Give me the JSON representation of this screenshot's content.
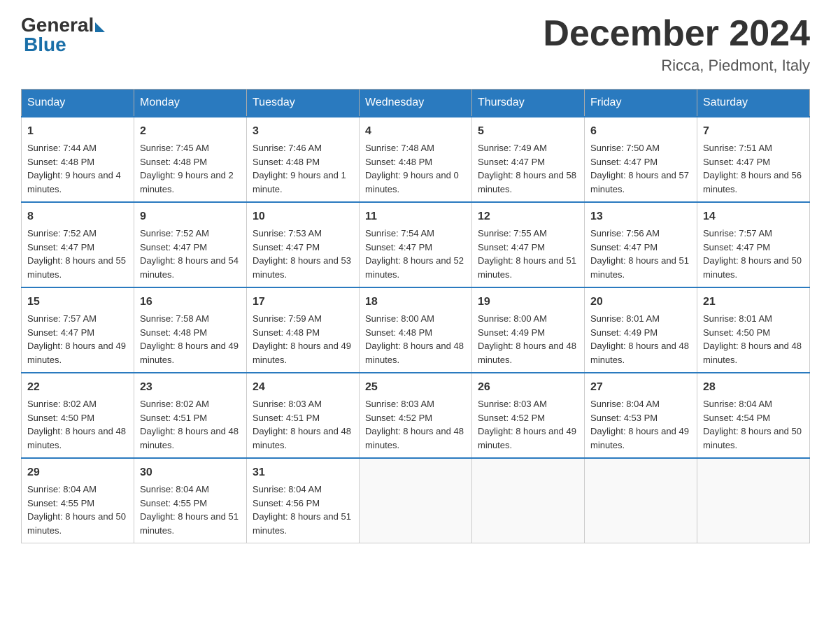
{
  "logo": {
    "general": "General",
    "blue": "Blue"
  },
  "title": "December 2024",
  "subtitle": "Ricca, Piedmont, Italy",
  "days_of_week": [
    "Sunday",
    "Monday",
    "Tuesday",
    "Wednesday",
    "Thursday",
    "Friday",
    "Saturday"
  ],
  "weeks": [
    [
      {
        "day": "1",
        "sunrise": "7:44 AM",
        "sunset": "4:48 PM",
        "daylight": "9 hours and 4 minutes."
      },
      {
        "day": "2",
        "sunrise": "7:45 AM",
        "sunset": "4:48 PM",
        "daylight": "9 hours and 2 minutes."
      },
      {
        "day": "3",
        "sunrise": "7:46 AM",
        "sunset": "4:48 PM",
        "daylight": "9 hours and 1 minute."
      },
      {
        "day": "4",
        "sunrise": "7:48 AM",
        "sunset": "4:48 PM",
        "daylight": "9 hours and 0 minutes."
      },
      {
        "day": "5",
        "sunrise": "7:49 AM",
        "sunset": "4:47 PM",
        "daylight": "8 hours and 58 minutes."
      },
      {
        "day": "6",
        "sunrise": "7:50 AM",
        "sunset": "4:47 PM",
        "daylight": "8 hours and 57 minutes."
      },
      {
        "day": "7",
        "sunrise": "7:51 AM",
        "sunset": "4:47 PM",
        "daylight": "8 hours and 56 minutes."
      }
    ],
    [
      {
        "day": "8",
        "sunrise": "7:52 AM",
        "sunset": "4:47 PM",
        "daylight": "8 hours and 55 minutes."
      },
      {
        "day": "9",
        "sunrise": "7:52 AM",
        "sunset": "4:47 PM",
        "daylight": "8 hours and 54 minutes."
      },
      {
        "day": "10",
        "sunrise": "7:53 AM",
        "sunset": "4:47 PM",
        "daylight": "8 hours and 53 minutes."
      },
      {
        "day": "11",
        "sunrise": "7:54 AM",
        "sunset": "4:47 PM",
        "daylight": "8 hours and 52 minutes."
      },
      {
        "day": "12",
        "sunrise": "7:55 AM",
        "sunset": "4:47 PM",
        "daylight": "8 hours and 51 minutes."
      },
      {
        "day": "13",
        "sunrise": "7:56 AM",
        "sunset": "4:47 PM",
        "daylight": "8 hours and 51 minutes."
      },
      {
        "day": "14",
        "sunrise": "7:57 AM",
        "sunset": "4:47 PM",
        "daylight": "8 hours and 50 minutes."
      }
    ],
    [
      {
        "day": "15",
        "sunrise": "7:57 AM",
        "sunset": "4:47 PM",
        "daylight": "8 hours and 49 minutes."
      },
      {
        "day": "16",
        "sunrise": "7:58 AM",
        "sunset": "4:48 PM",
        "daylight": "8 hours and 49 minutes."
      },
      {
        "day": "17",
        "sunrise": "7:59 AM",
        "sunset": "4:48 PM",
        "daylight": "8 hours and 49 minutes."
      },
      {
        "day": "18",
        "sunrise": "8:00 AM",
        "sunset": "4:48 PM",
        "daylight": "8 hours and 48 minutes."
      },
      {
        "day": "19",
        "sunrise": "8:00 AM",
        "sunset": "4:49 PM",
        "daylight": "8 hours and 48 minutes."
      },
      {
        "day": "20",
        "sunrise": "8:01 AM",
        "sunset": "4:49 PM",
        "daylight": "8 hours and 48 minutes."
      },
      {
        "day": "21",
        "sunrise": "8:01 AM",
        "sunset": "4:50 PM",
        "daylight": "8 hours and 48 minutes."
      }
    ],
    [
      {
        "day": "22",
        "sunrise": "8:02 AM",
        "sunset": "4:50 PM",
        "daylight": "8 hours and 48 minutes."
      },
      {
        "day": "23",
        "sunrise": "8:02 AM",
        "sunset": "4:51 PM",
        "daylight": "8 hours and 48 minutes."
      },
      {
        "day": "24",
        "sunrise": "8:03 AM",
        "sunset": "4:51 PM",
        "daylight": "8 hours and 48 minutes."
      },
      {
        "day": "25",
        "sunrise": "8:03 AM",
        "sunset": "4:52 PM",
        "daylight": "8 hours and 48 minutes."
      },
      {
        "day": "26",
        "sunrise": "8:03 AM",
        "sunset": "4:52 PM",
        "daylight": "8 hours and 49 minutes."
      },
      {
        "day": "27",
        "sunrise": "8:04 AM",
        "sunset": "4:53 PM",
        "daylight": "8 hours and 49 minutes."
      },
      {
        "day": "28",
        "sunrise": "8:04 AM",
        "sunset": "4:54 PM",
        "daylight": "8 hours and 50 minutes."
      }
    ],
    [
      {
        "day": "29",
        "sunrise": "8:04 AM",
        "sunset": "4:55 PM",
        "daylight": "8 hours and 50 minutes."
      },
      {
        "day": "30",
        "sunrise": "8:04 AM",
        "sunset": "4:55 PM",
        "daylight": "8 hours and 51 minutes."
      },
      {
        "day": "31",
        "sunrise": "8:04 AM",
        "sunset": "4:56 PM",
        "daylight": "8 hours and 51 minutes."
      },
      null,
      null,
      null,
      null
    ]
  ],
  "labels": {
    "sunrise": "Sunrise:",
    "sunset": "Sunset:",
    "daylight": "Daylight:"
  }
}
